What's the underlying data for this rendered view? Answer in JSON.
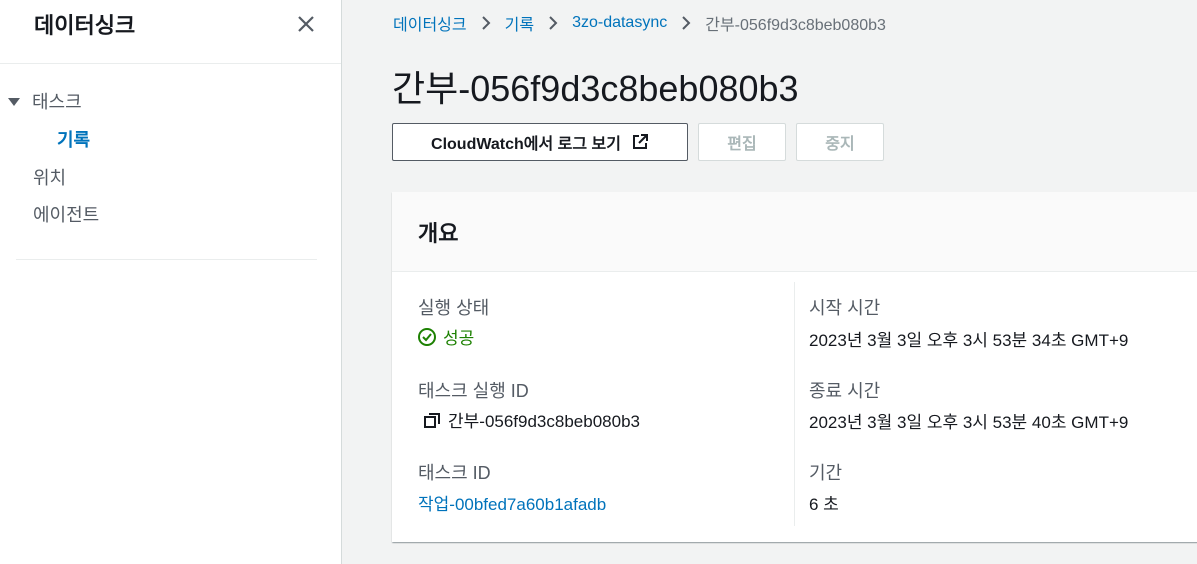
{
  "sidebar": {
    "title": "데이터싱크",
    "group_label": "태스크",
    "items": [
      {
        "label": "기록",
        "active": true
      },
      {
        "label": "위치",
        "active": false
      },
      {
        "label": "에이전트",
        "active": false
      }
    ]
  },
  "breadcrumb": [
    {
      "label": "데이터싱크",
      "link": true
    },
    {
      "label": "기록",
      "link": true
    },
    {
      "label": "3zo-datasync",
      "link": true
    },
    {
      "label": "간부-056f9d3c8beb080b3",
      "link": false
    }
  ],
  "page_title": "간부-056f9d3c8beb080b3",
  "buttons": {
    "cloudwatch": "CloudWatch에서 로그 보기",
    "edit": "편집",
    "stop": "중지"
  },
  "overview": {
    "title": "개요",
    "execution_status": {
      "label": "실행 상태",
      "value": "성공"
    },
    "task_execution_id": {
      "label": "태스크 실행 ID",
      "value": "간부-056f9d3c8beb080b3"
    },
    "task_id": {
      "label": "태스크 ID",
      "value": "작업-00bfed7a60b1afadb"
    },
    "start_time": {
      "label": "시작 시간",
      "value": "2023년 3월 3일 오후 3시 53분 34초 GMT+9"
    },
    "end_time": {
      "label": "종료 시간",
      "value": "2023년 3월 3일 오후 3시 53분 40초 GMT+9"
    },
    "duration": {
      "label": "기간",
      "value": "6 초"
    }
  },
  "colors": {
    "link": "#0073bb",
    "success": "#1d8102",
    "text": "#16191f",
    "muted": "#545b64"
  },
  "icons": [
    "close-icon",
    "caret-down-icon",
    "chevron-right-icon",
    "external-link-icon",
    "success-check-icon",
    "copy-icon"
  ]
}
